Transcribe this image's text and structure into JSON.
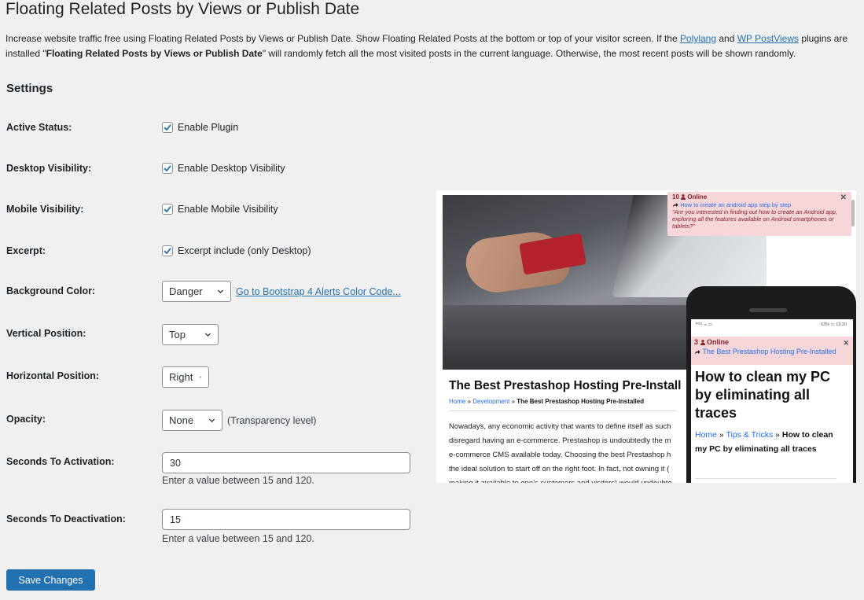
{
  "page": {
    "title": "Floating Related Posts by Views or Publish Date",
    "intro": {
      "part1": "Increase website traffic free using Floating Related Posts by Views or Publish Date. Show Floating Related Posts at the bottom or top of your visitor screen. If the ",
      "link_polylang": "Polylang",
      "part2": " and ",
      "link_postviews": "WP PostViews",
      "part3": " plugins are installed \"",
      "bold": "Floating Related Posts by Views or Publish Date",
      "part4": "\" will randomly fetch all the most visited posts in the current language. Otherwise, the most recent posts will be shown randomly."
    },
    "settings_heading": "Settings"
  },
  "settings": {
    "active_status": {
      "label": "Active Status:",
      "checkbox_label": "Enable Plugin",
      "checked": true
    },
    "desktop_visibility": {
      "label": "Desktop Visibility:",
      "checkbox_label": "Enable Desktop Visibility",
      "checked": true
    },
    "mobile_visibility": {
      "label": "Mobile Visibility:",
      "checkbox_label": "Enable Mobile Visibility",
      "checked": true
    },
    "excerpt": {
      "label": "Excerpt:",
      "checkbox_label": "Excerpt include (only Desktop)",
      "checked": true
    },
    "background_color": {
      "label": "Background Color:",
      "selected": "Danger",
      "link": "Go to Bootstrap 4 Alerts Color Code..."
    },
    "vertical_position": {
      "label": "Vertical Position:",
      "selected": "Top"
    },
    "horizontal_position": {
      "label": "Horizontal Position:",
      "selected": "Right"
    },
    "opacity": {
      "label": "Opacity:",
      "selected": "None",
      "note": "(Transparency level)"
    },
    "seconds_activation": {
      "label": "Seconds To Activation:",
      "value": "30",
      "hint": "Enter a value between 15 and 120."
    },
    "seconds_deactivation": {
      "label": "Seconds To Deactivation:",
      "value": "15",
      "hint": "Enter a value between 15 and 120."
    }
  },
  "save_button": "Save Changes",
  "preview": {
    "desktop_notice": {
      "count": "10",
      "status": "Online",
      "link": "How to create an android app step by step",
      "quote": "\"Are you interested in finding out how to create an Android app, exploring all the features available on Android smartphones or tablets?\""
    },
    "post_title": "The Best Prestashop Hosting Pre-Install",
    "crumbs": {
      "home": "Home",
      "sep": " » ",
      "category": "Development",
      "current": "The Best Prestashop Hosting Pre-Installed"
    },
    "body_lines": [
      "Nowadays, any economic activity that wants to define itself as such",
      "disregard having an e-commerce. Prestashop is undoubtedly the m",
      "e-commerce CMS available today. Choosing the best Prestashop h",
      "the ideal solution to start off on the right foot. In fact, not owning it (",
      "making it available to one's customers and visitors) would undoubte"
    ],
    "phone": {
      "status_left": "ᴿᴼᴸᴸ ₘ ▭",
      "status_right": "63% ▭ 13:20",
      "count": "3",
      "status": "Online",
      "link": "The Best Prestashop Hosting Pre-Installed",
      "title": "How to clean my PC by eliminating all traces",
      "crumbs": {
        "home": "Home",
        "sep": " » ",
        "category": "Tips & Tricks",
        "current": "How to clean my PC by eliminating all traces"
      }
    }
  },
  "colors": {
    "accent": "#2271b1",
    "danger_bg": "#f7d6da",
    "danger_text": "#842029"
  }
}
